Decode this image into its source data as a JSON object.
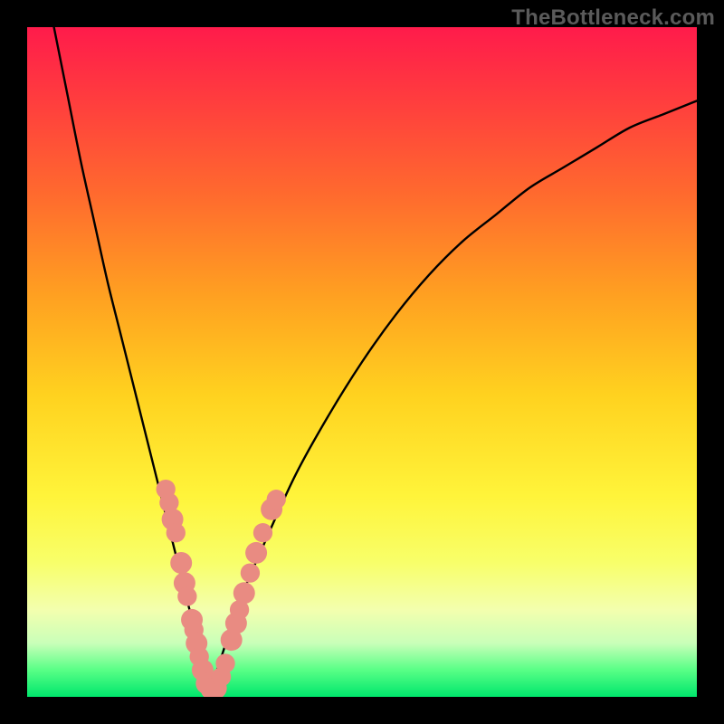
{
  "watermark": "TheBottleneck.com",
  "colors": {
    "frame": "#000000",
    "bead": "#e98b82",
    "curve": "#000000",
    "gradient_top": "#ff1b4b",
    "gradient_bottom": "#00e66c"
  },
  "chart_data": {
    "type": "line",
    "title": "",
    "xlabel": "",
    "ylabel": "",
    "xlim": [
      0,
      100
    ],
    "ylim": [
      0,
      100
    ],
    "description": "V-shaped bottleneck curve with minimum near x≈27; background hue encodes y (red=high bottleneck, green=low). Salmon beads mark sample points near the trough.",
    "series": [
      {
        "name": "bottleneck-curve",
        "x": [
          4,
          6,
          8,
          10,
          12,
          14,
          16,
          18,
          20,
          22,
          24,
          26,
          27,
          28,
          30,
          32,
          35,
          40,
          45,
          50,
          55,
          60,
          65,
          70,
          75,
          80,
          85,
          90,
          95,
          100
        ],
        "y": [
          100,
          90,
          80,
          71,
          62,
          54,
          46,
          38,
          30,
          22,
          14,
          6,
          1,
          3,
          9,
          15,
          22,
          33,
          42,
          50,
          57,
          63,
          68,
          72,
          76,
          79,
          82,
          85,
          87,
          89
        ]
      }
    ],
    "beads_left": [
      {
        "x": 20.7,
        "y": 31.0,
        "r": 1.0
      },
      {
        "x": 21.2,
        "y": 29.0,
        "r": 1.0
      },
      {
        "x": 21.7,
        "y": 26.5,
        "r": 1.2
      },
      {
        "x": 22.2,
        "y": 24.5,
        "r": 1.0
      },
      {
        "x": 23.0,
        "y": 20.0,
        "r": 1.2
      },
      {
        "x": 23.5,
        "y": 17.0,
        "r": 1.2
      },
      {
        "x": 23.9,
        "y": 15.0,
        "r": 1.0
      },
      {
        "x": 24.6,
        "y": 11.5,
        "r": 1.2
      },
      {
        "x": 24.9,
        "y": 10.0,
        "r": 1.0
      },
      {
        "x": 25.3,
        "y": 8.0,
        "r": 1.2
      },
      {
        "x": 25.7,
        "y": 6.0,
        "r": 1.0
      },
      {
        "x": 26.2,
        "y": 4.0,
        "r": 1.2
      },
      {
        "x": 26.8,
        "y": 2.0,
        "r": 1.2
      },
      {
        "x": 27.5,
        "y": 1.2,
        "r": 1.2
      },
      {
        "x": 28.2,
        "y": 1.3,
        "r": 1.2
      }
    ],
    "beads_right": [
      {
        "x": 29.0,
        "y": 3.0,
        "r": 1.0
      },
      {
        "x": 29.6,
        "y": 5.0,
        "r": 1.0
      },
      {
        "x": 30.5,
        "y": 8.5,
        "r": 1.2
      },
      {
        "x": 31.2,
        "y": 11.0,
        "r": 1.2
      },
      {
        "x": 31.7,
        "y": 13.0,
        "r": 1.0
      },
      {
        "x": 32.4,
        "y": 15.5,
        "r": 1.2
      },
      {
        "x": 33.3,
        "y": 18.5,
        "r": 1.0
      },
      {
        "x": 34.2,
        "y": 21.5,
        "r": 1.2
      },
      {
        "x": 35.2,
        "y": 24.5,
        "r": 1.0
      },
      {
        "x": 36.5,
        "y": 28.0,
        "r": 1.2
      },
      {
        "x": 37.2,
        "y": 29.5,
        "r": 1.0
      }
    ]
  }
}
